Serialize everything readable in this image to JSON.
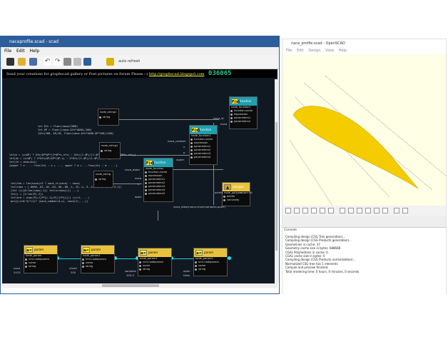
{
  "editor": {
    "title": "nacaprofile.scad - scad",
    "menu": [
      "File",
      "Edit",
      "Help"
    ],
    "toolbar_label": "auto refresh",
    "banner_text": "Send your creations for graphscad gallery or Post pictures on forum Please :-)",
    "banner_link": "http://graphscad.blogspot.com",
    "version": "036065",
    "code_blocks": [
      "let $fn = floor(naca/1000)\nlet $P = floor((naca-$fn*1000)/100)\n[$fn/100, $P/10, floor(naca-$fn*1000-$P*100)/100]",
      "let(m = (x<$P) ? $fn/$P*$P*(2*$P*x-x*x) : $fn/(1-$P)/(1-$P)*((1-2*$P)+2*$P*x-x*x))\nlet(dx = (x<$P) ? 2*$fn/$P/$P*($P-x) : 2*$fn/(1-$P)/(1-$P)*($P-x))\nlet(th = atan(dx))\n[upper ? x - ...*sin(th) : x + ..., upper ? m + ...*cos(th) : m - ...]",
      "let(tha = len(naca)>3 ? naca_ct(naca) : naca)\nlet(rows = [.0005,.01,.02,.04,.06,.08,.1,.15,.2,.3,.4,.5,.6,.7,.8,.9,1])\n[for (i=[0:len(rows)-1]) let(x=rows[i]) ...]\nlet(j = [1:len(P)-2])\nlet(ord = sign(P[+1]*P[j-1]+P[j]*P[j])) (j>=1, ...)\npoly[(i=0:3)*(1)* (naca_camber(d,n), naca(2),...)]"
    ],
    "nodes": {
      "string1": {
        "title": "node_string1",
        "rows": [
          "string",
          "string"
        ]
      },
      "string2": {
        "title": "node_string1",
        "rows": [
          "string",
          "string"
        ]
      },
      "string3": {
        "title": "node_string",
        "rows": [
          "string",
          "string"
        ]
      },
      "function1": {
        "title": "node_function1",
        "header": "function",
        "rows": [
          "function-name",
          "expression",
          "parameters1",
          "parameters2"
        ]
      },
      "function2": {
        "title": "node_function1",
        "header": "function",
        "rows": [
          "function-name",
          "expression",
          "parameters1",
          "parameters2",
          "parameters3",
          "parameters4"
        ]
      },
      "function3": {
        "title": "node_function",
        "header": "function",
        "rows": [
          "function-name",
          "expression",
          "parameters1",
          "parameters2",
          "parameters3",
          "parameters4",
          "parameters5"
        ]
      },
      "polygon": {
        "title": "node_polygon",
        "header": "polygon",
        "rows": [
          "points",
          "convexity"
        ]
      },
      "param1": {
        "title": "node_param",
        "header": "param",
        "rows": [
          "nmr-nodeparam",
          "name",
          "string"
        ]
      },
      "param2": {
        "title": "node_param1",
        "header": "param",
        "rows": [
          "nmr-nodeparam",
          "name",
          "string"
        ]
      },
      "param3": {
        "title": "node_param1",
        "header": "param",
        "rows": [
          "nmr-nodeparam",
          "name",
          "string"
        ]
      },
      "param4": {
        "title": "node_param2",
        "header": "param",
        "rows": [
          "nmr-nodeparam",
          "name",
          "string"
        ]
      }
    },
    "labels": {
      "naca_id": "naca_id",
      "naca": "naca",
      "naca_camber": "naca_camber",
      "x": "x",
      "p": "p",
      "upper": "upper",
      "naca_dat": "naca_datar",
      "naca2": "naca",
      "n": "n",
      "open": "open",
      "bottom_call": "naca_datar(naca,chord,samples,open)",
      "v_naca": "naca",
      "v_2412": "2412",
      "v_chord": "chord",
      "v_200": "200",
      "v_samples": "samples",
      "v_100": "100.0",
      "v_open": "open",
      "v_false": "false",
      "points_label": "points",
      "poly_out": "object3d"
    }
  },
  "viewer": {
    "title": "naca_profile.scad - OpenSCAD",
    "menu": [
      "File",
      "Edit",
      "Design",
      "View",
      "Help"
    ],
    "console_title": "Console",
    "console_lines": [
      "Compiling design (CSG Tree generation)...",
      "Compiling design (CSG Products generation)...",
      "Geometries in cache: 37",
      "Geometry cache size in bytes: 688688",
      "CGAL Polyhedrons in cache: 0",
      "CGAL cache size in bytes: 0",
      "Compiling design (CSG Products normalization)...",
      "Normalized CSG tree has 1 elements",
      "Compile and preview finished.",
      "Total rendering time: 0 hours, 0 minutes, 0 seconds"
    ]
  },
  "colors": {
    "accent": "#1e9fb0",
    "wire": "#22d2e6",
    "airfoil": "#f5cc00",
    "canvas": "#101821"
  }
}
